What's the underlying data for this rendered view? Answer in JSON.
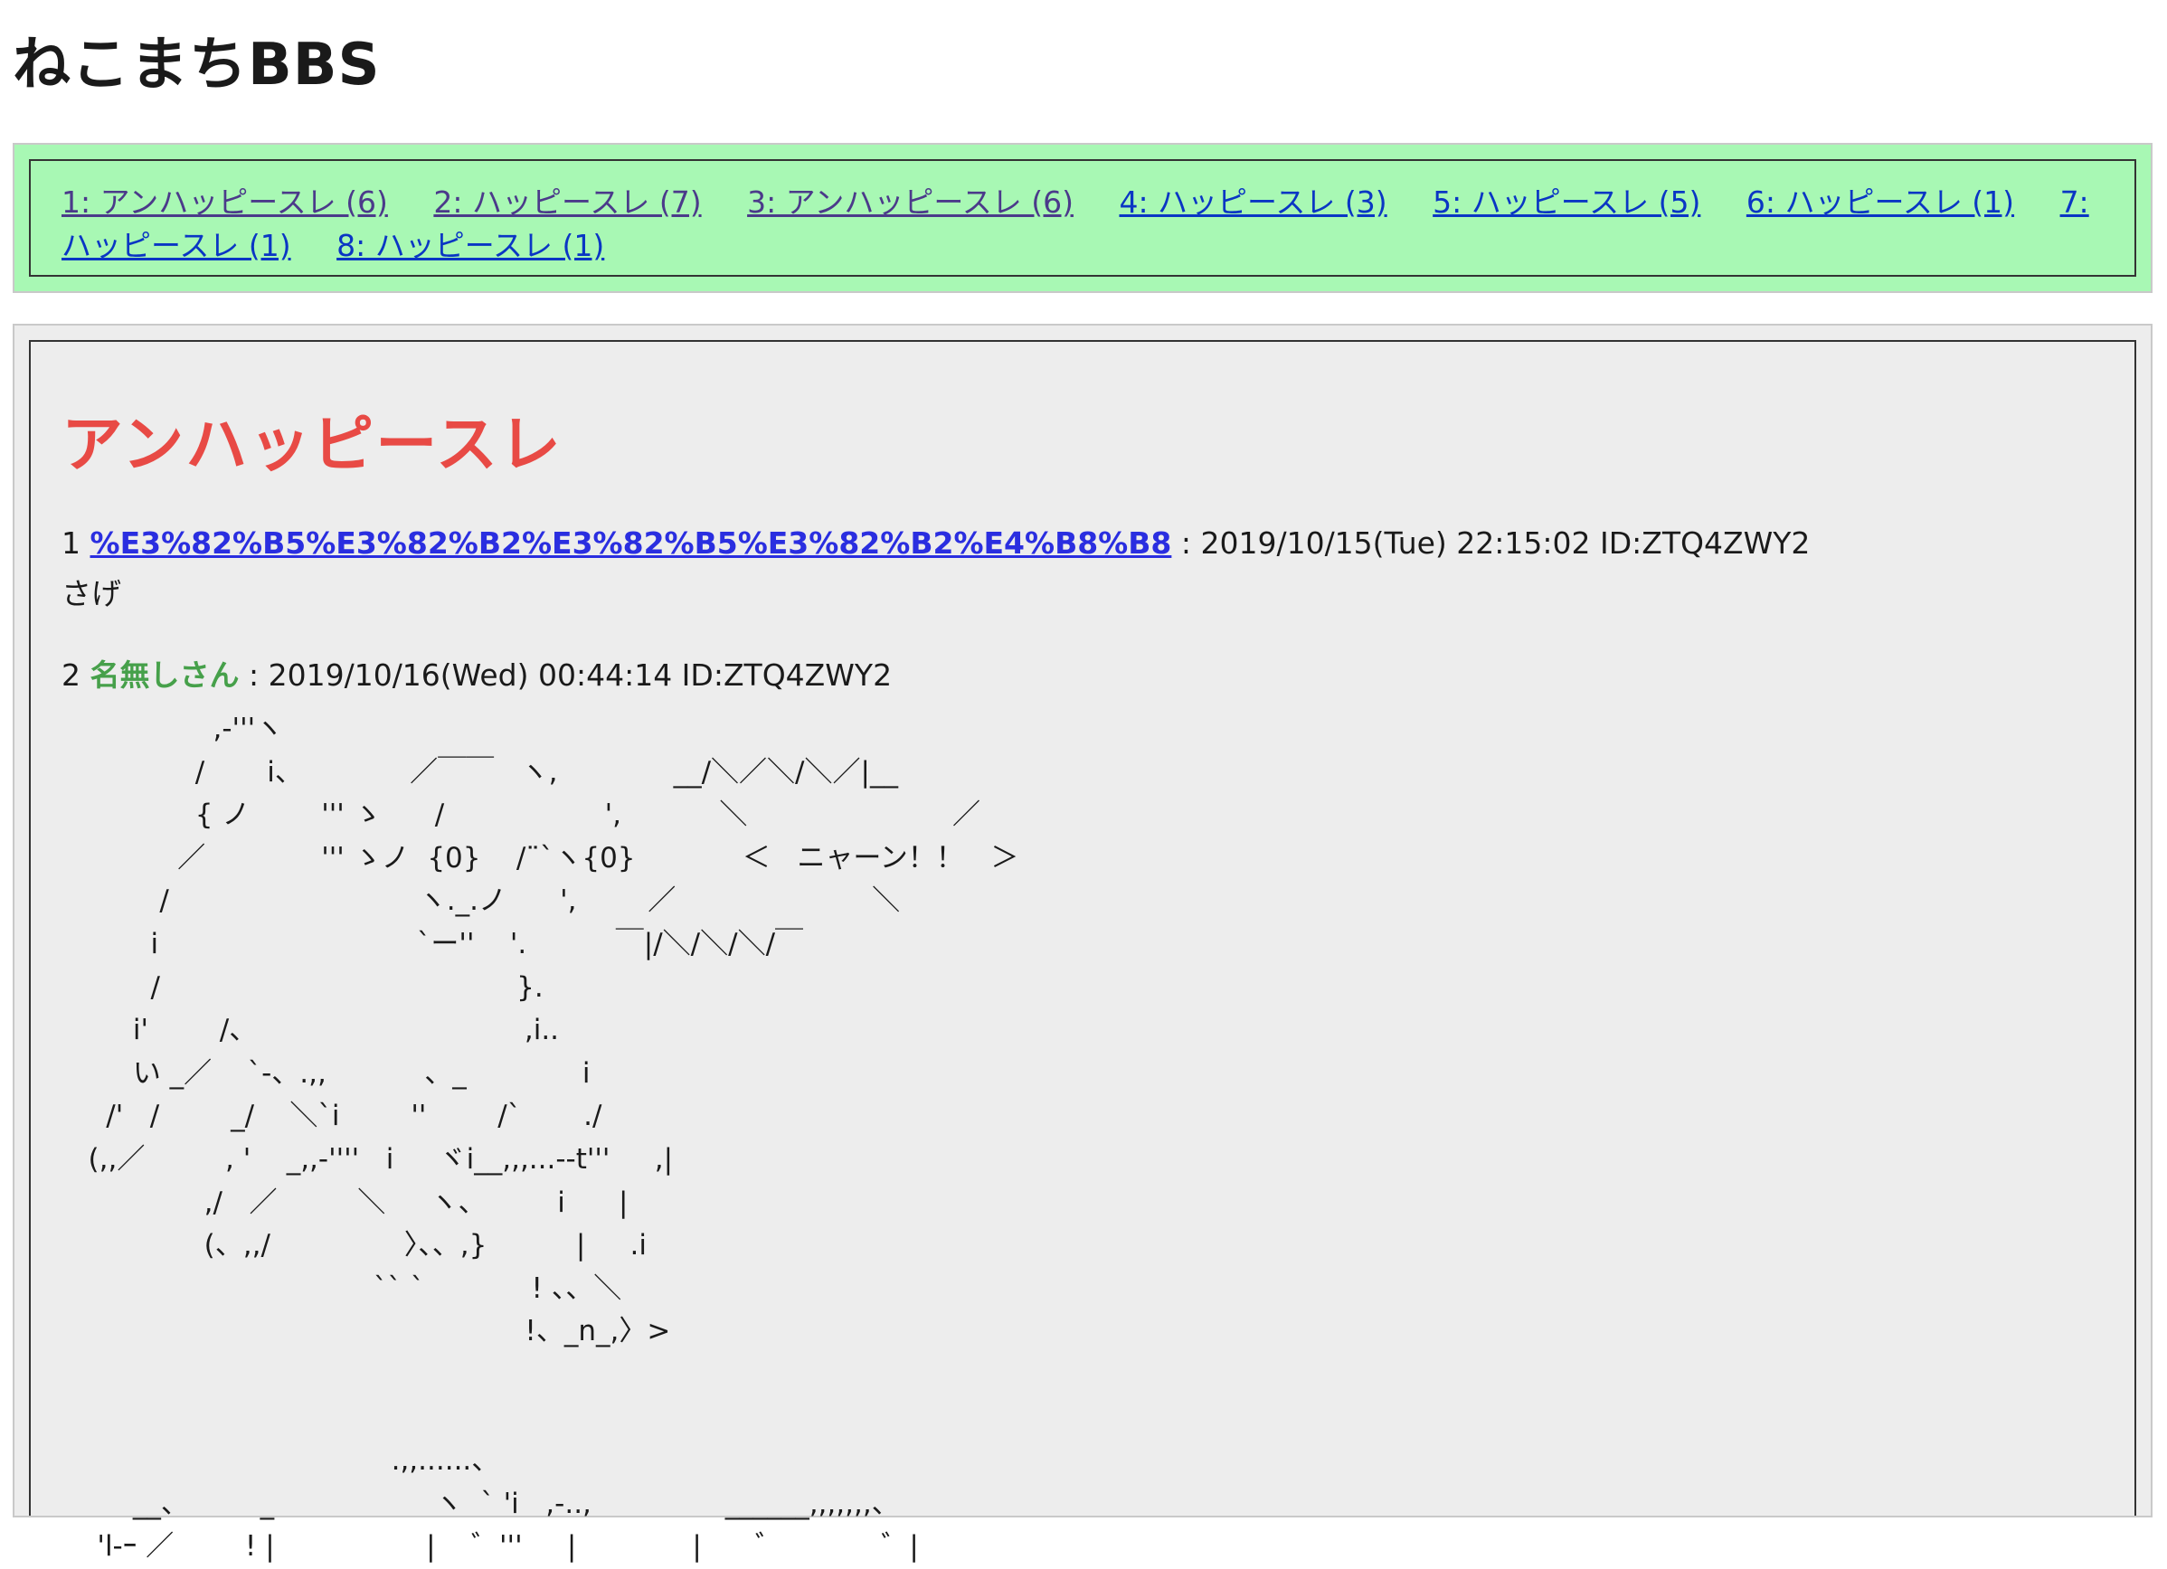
{
  "site": {
    "title": "ねこまちBBS"
  },
  "nav": {
    "threads": [
      {
        "label": "1: アンハッピースレ (6)"
      },
      {
        "label": "2: ハッピースレ (7)"
      },
      {
        "label": "3: アンハッピースレ (6)"
      },
      {
        "label": "4: ハッピースレ (3)"
      },
      {
        "label": "5: ハッピースレ (5)"
      },
      {
        "label": "6: ハッピースレ (1)"
      },
      {
        "label": "7: ハッピースレ (1)"
      },
      {
        "label": "8: ハッピースレ (1)"
      }
    ]
  },
  "thread": {
    "title": "アンハッピースレ",
    "posts": [
      {
        "number": "1",
        "name": "%E3%82%B5%E3%82%B2%E3%82%B5%E3%82%B2%E4%B8%B8",
        "meta": " : 2019/10/15(Tue) 22:15:02 ID:ZTQ4ZWY2",
        "body": "さげ"
      },
      {
        "number": "2",
        "name": "名無しさん",
        "meta": " : 2019/10/16(Wed) 00:44:14 ID:ZTQ4ZWY2",
        "body": "                 ,-'''ヽ\n               /       i、            ／￣￣   ヽ,             __/＼／＼/＼／|__\n               { ノ        ''' ゝ      /                  ',           ＼                       ／\n             ／             ''' ゝノ  {0}    /¨`ヽ{0}            ＜   ニャーン！！   ＞\n           /                            ヽ._.ノ      ',        ／                      ＼\n          i                             `ー''    '.          ￣|/＼/＼/＼/￣\n          /                                        }.\n        i'        /、                              ,i..\n        い _／    `-、.,,           、_             i\n     /'   /        _/    ＼`i        ''        /`       ./\n   (,,／         , '    _,,-''''   i     ヾi__,,,...--t'''     ,|\n                ,/   ／         ＼     ヽ、        i      |\n                (、,,/               〉、、,}          |     .i\n                                   `` `            ! 、、＼\n                                                    !、_n_,〉>\n\n\n                                     .,,......、\n        __、        _                  ヽ  ` 'i   ,-..,               ______,,,,,,,、\n    'l-ｰ ／        ! |                 |    ゛'''     |             |      ゛           ゛|"
      }
    ]
  }
}
